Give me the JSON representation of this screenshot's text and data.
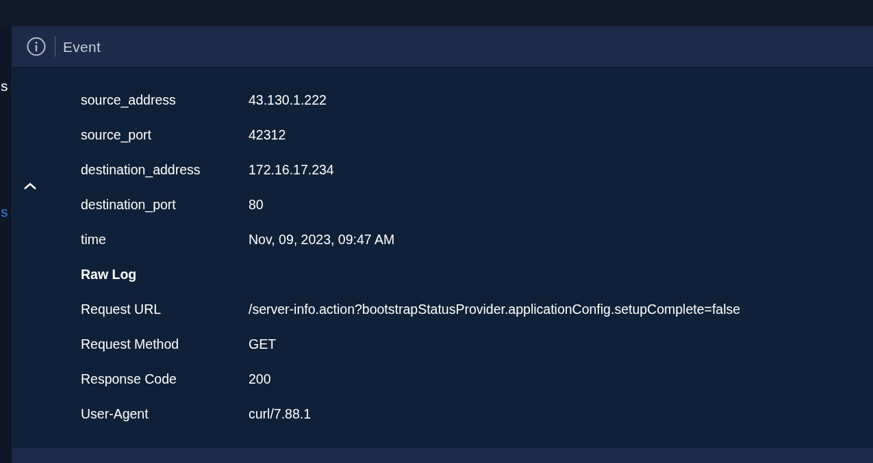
{
  "sidebar_fragments": [
    {
      "text": "s",
      "selected": false
    },
    {
      "text": "s",
      "selected": true
    }
  ],
  "panel": {
    "title": "Event",
    "expanded": true
  },
  "rows": [
    {
      "kind": "field",
      "label": "source_address",
      "value": "43.130.1.222"
    },
    {
      "kind": "field",
      "label": "source_port",
      "value": "42312"
    },
    {
      "kind": "field",
      "label": "destination_address",
      "value": "172.16.17.234"
    },
    {
      "kind": "field",
      "label": "destination_port",
      "value": "80"
    },
    {
      "kind": "field",
      "label": "time",
      "value": "Nov, 09, 2023, 09:47 AM"
    },
    {
      "kind": "heading",
      "label": "Raw Log"
    },
    {
      "kind": "field",
      "label": "Request URL",
      "value": "/server-info.action?bootstrapStatusProvider.applicationConfig.setupComplete=false"
    },
    {
      "kind": "field",
      "label": "Request Method",
      "value": "GET"
    },
    {
      "kind": "field",
      "label": "Response Code",
      "value": "200"
    },
    {
      "kind": "field",
      "label": "User-Agent",
      "value": "curl/7.88.1"
    }
  ]
}
